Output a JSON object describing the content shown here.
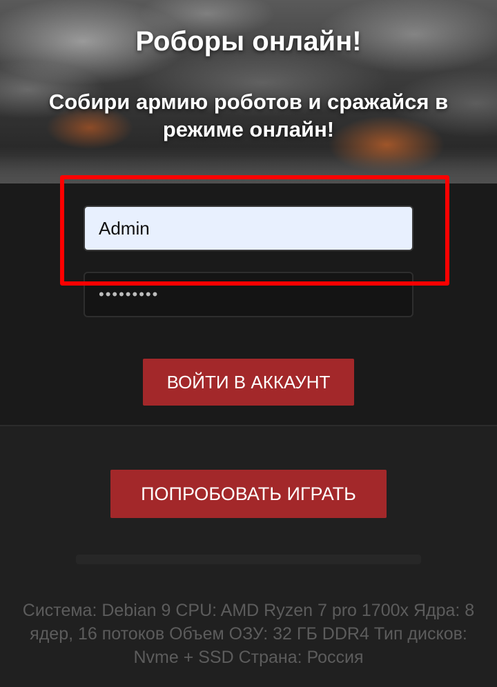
{
  "hero": {
    "title": "Роборы онлайн!",
    "subtitle": "Собири армию роботов и сражайся в режиме онлайн!"
  },
  "login": {
    "username_value": "Admin",
    "password_value": "•••••••••",
    "login_button": "ВОЙТИ В АККАУНТ"
  },
  "play": {
    "button": "ПОПРОБОВАТЬ ИГРАТЬ"
  },
  "specs": {
    "text": "Система: Debian 9 CPU: AMD Ryzen 7 pro 1700x Ядра: 8 ядер, 16 потоков Объем ОЗУ: 32 ГБ DDR4 Тип дисков: Nvme + SSD Страна: Россия"
  },
  "colors": {
    "accent_button": "#a3282a",
    "highlight_box": "#ff0000",
    "autofill_input": "#e8f0fe"
  }
}
